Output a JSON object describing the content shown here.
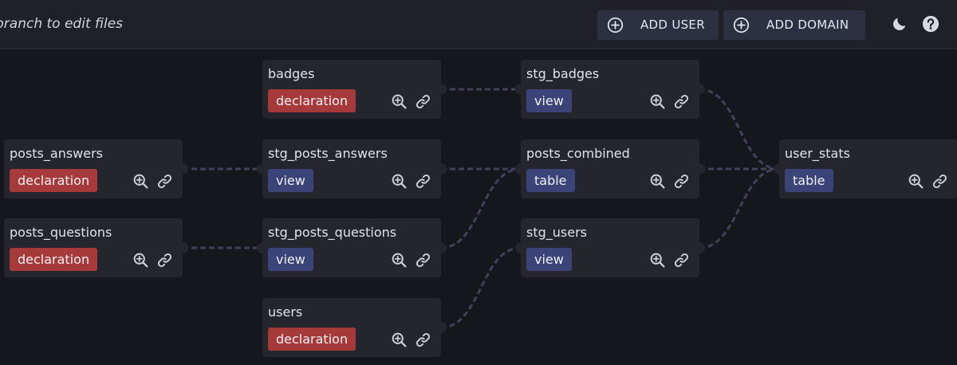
{
  "topbar": {
    "message": "branch to edit files",
    "add_user_label": "ADD USER",
    "add_domain_label": "ADD DOMAIN"
  },
  "nodes": {
    "badges": {
      "title": "badges",
      "type": "declaration"
    },
    "posts_answers": {
      "title": "posts_answers",
      "type": "declaration"
    },
    "posts_questions": {
      "title": "posts_questions",
      "type": "declaration"
    },
    "stg_posts_answers": {
      "title": "stg_posts_answers",
      "type": "view"
    },
    "stg_posts_questions": {
      "title": "stg_posts_questions",
      "type": "view"
    },
    "users": {
      "title": "users",
      "type": "declaration"
    },
    "stg_badges": {
      "title": "stg_badges",
      "type": "view"
    },
    "posts_combined": {
      "title": "posts_combined",
      "type": "table"
    },
    "stg_users": {
      "title": "stg_users",
      "type": "view"
    },
    "user_stats": {
      "title": "user_stats",
      "type": "table"
    }
  },
  "edges": [
    {
      "from": "badges",
      "to": "stg_badges"
    },
    {
      "from": "posts_answers",
      "to": "stg_posts_answers"
    },
    {
      "from": "posts_questions",
      "to": "stg_posts_questions"
    },
    {
      "from": "stg_posts_answers",
      "to": "posts_combined"
    },
    {
      "from": "stg_posts_questions",
      "to": "posts_combined"
    },
    {
      "from": "users",
      "to": "stg_users"
    },
    {
      "from": "stg_badges",
      "to": "user_stats"
    },
    {
      "from": "posts_combined",
      "to": "user_stats"
    },
    {
      "from": "stg_users",
      "to": "user_stats"
    }
  ],
  "colors": {
    "declaration": "#a63a3a",
    "view": "#3b4478",
    "table": "#3b4478",
    "edge": "#40425c"
  },
  "icons": {
    "zoom": "zoom-in-icon",
    "link": "link-icon",
    "add": "plus-circle-icon",
    "theme": "moon-icon",
    "help": "help-icon"
  }
}
